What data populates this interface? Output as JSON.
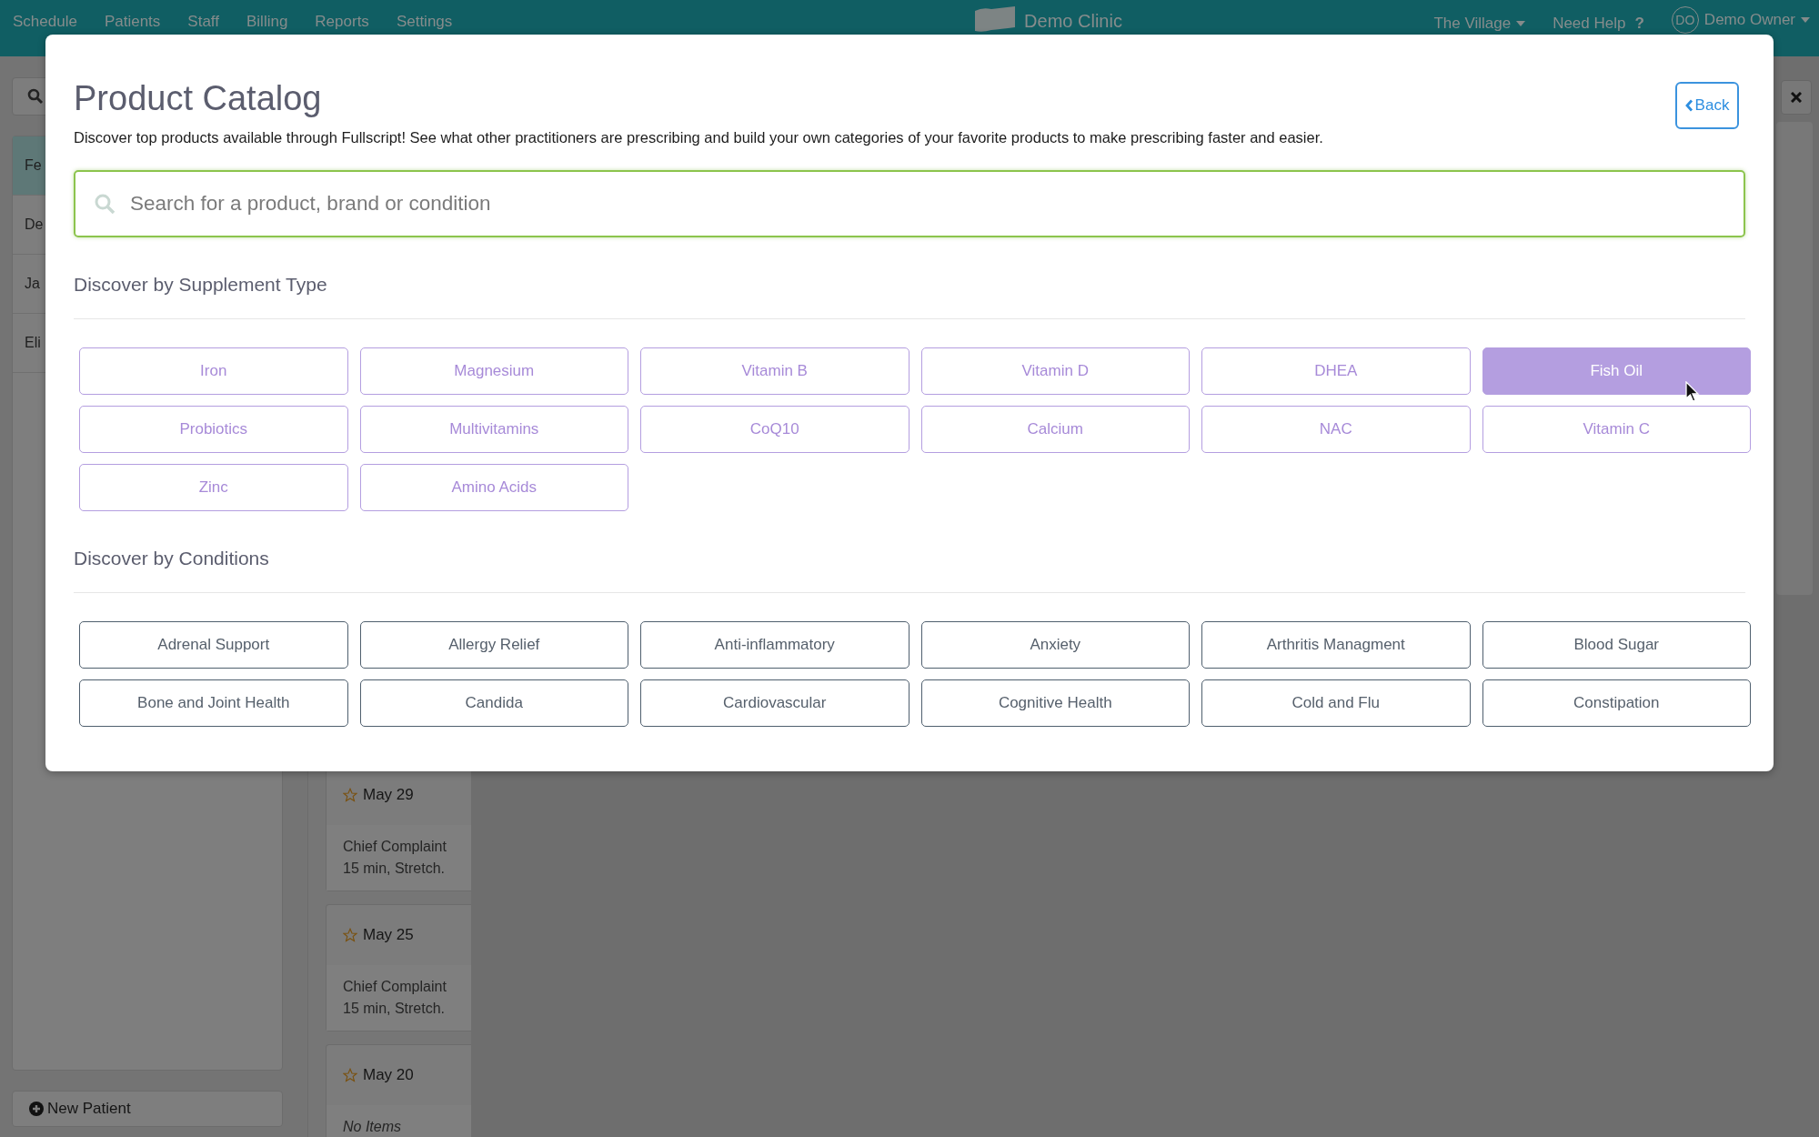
{
  "nav": {
    "items": [
      "Schedule",
      "Patients",
      "Staff",
      "Billing",
      "Reports",
      "Settings"
    ],
    "brand": "Demo Clinic",
    "location": "The Village",
    "help": "Need Help",
    "help_mark": "?",
    "user_initials": "DO",
    "user": "Demo Owner"
  },
  "sidebar": {
    "patients": [
      {
        "name": "Fe",
        "selected": true
      },
      {
        "name": "De",
        "selected": false
      },
      {
        "name": "Ja",
        "selected": false
      },
      {
        "name": "Eli",
        "selected": false
      }
    ],
    "new_patient": "New Patient"
  },
  "timeline": [
    {
      "date": "May 29",
      "lines": [
        "Chief Complaint",
        "15 min, Stretch."
      ]
    },
    {
      "date": "May 25",
      "lines": [
        "Chief Complaint",
        "15 min, Stretch."
      ]
    },
    {
      "date": "May 20",
      "empty": "No Items"
    }
  ],
  "modal": {
    "title": "Product Catalog",
    "description": "Discover top products available through Fullscript! See what other practitioners are prescribing and build your own categories of your favorite products to make prescribing faster and easier.",
    "back": "Back",
    "search": {
      "placeholder": "Search for a product, brand or condition"
    },
    "sections": [
      {
        "heading": "Discover by Supplement Type",
        "kind": "supplement",
        "items": [
          {
            "label": "Iron",
            "selected": false
          },
          {
            "label": "Magnesium",
            "selected": false
          },
          {
            "label": "Vitamin B",
            "selected": false
          },
          {
            "label": "Vitamin D",
            "selected": false
          },
          {
            "label": "DHEA",
            "selected": false
          },
          {
            "label": "Fish Oil",
            "selected": true
          },
          {
            "label": "Probiotics",
            "selected": false
          },
          {
            "label": "Multivitamins",
            "selected": false
          },
          {
            "label": "CoQ10",
            "selected": false
          },
          {
            "label": "Calcium",
            "selected": false
          },
          {
            "label": "NAC",
            "selected": false
          },
          {
            "label": "Vitamin C",
            "selected": false
          },
          {
            "label": "Zinc",
            "selected": false
          },
          {
            "label": "Amino Acids",
            "selected": false
          }
        ]
      },
      {
        "heading": "Discover by Conditions",
        "kind": "condition",
        "items": [
          {
            "label": "Adrenal Support",
            "selected": false
          },
          {
            "label": "Allergy Relief",
            "selected": false
          },
          {
            "label": "Anti-inflammatory",
            "selected": false
          },
          {
            "label": "Anxiety",
            "selected": false
          },
          {
            "label": "Arthritis Managment",
            "selected": false
          },
          {
            "label": "Blood Sugar",
            "selected": false
          },
          {
            "label": "Bone and Joint Health",
            "selected": false
          },
          {
            "label": "Candida",
            "selected": false
          },
          {
            "label": "Cardiovascular",
            "selected": false
          },
          {
            "label": "Cognitive Health",
            "selected": false
          },
          {
            "label": "Cold and Flu",
            "selected": false
          },
          {
            "label": "Constipation",
            "selected": false
          }
        ]
      }
    ]
  }
}
